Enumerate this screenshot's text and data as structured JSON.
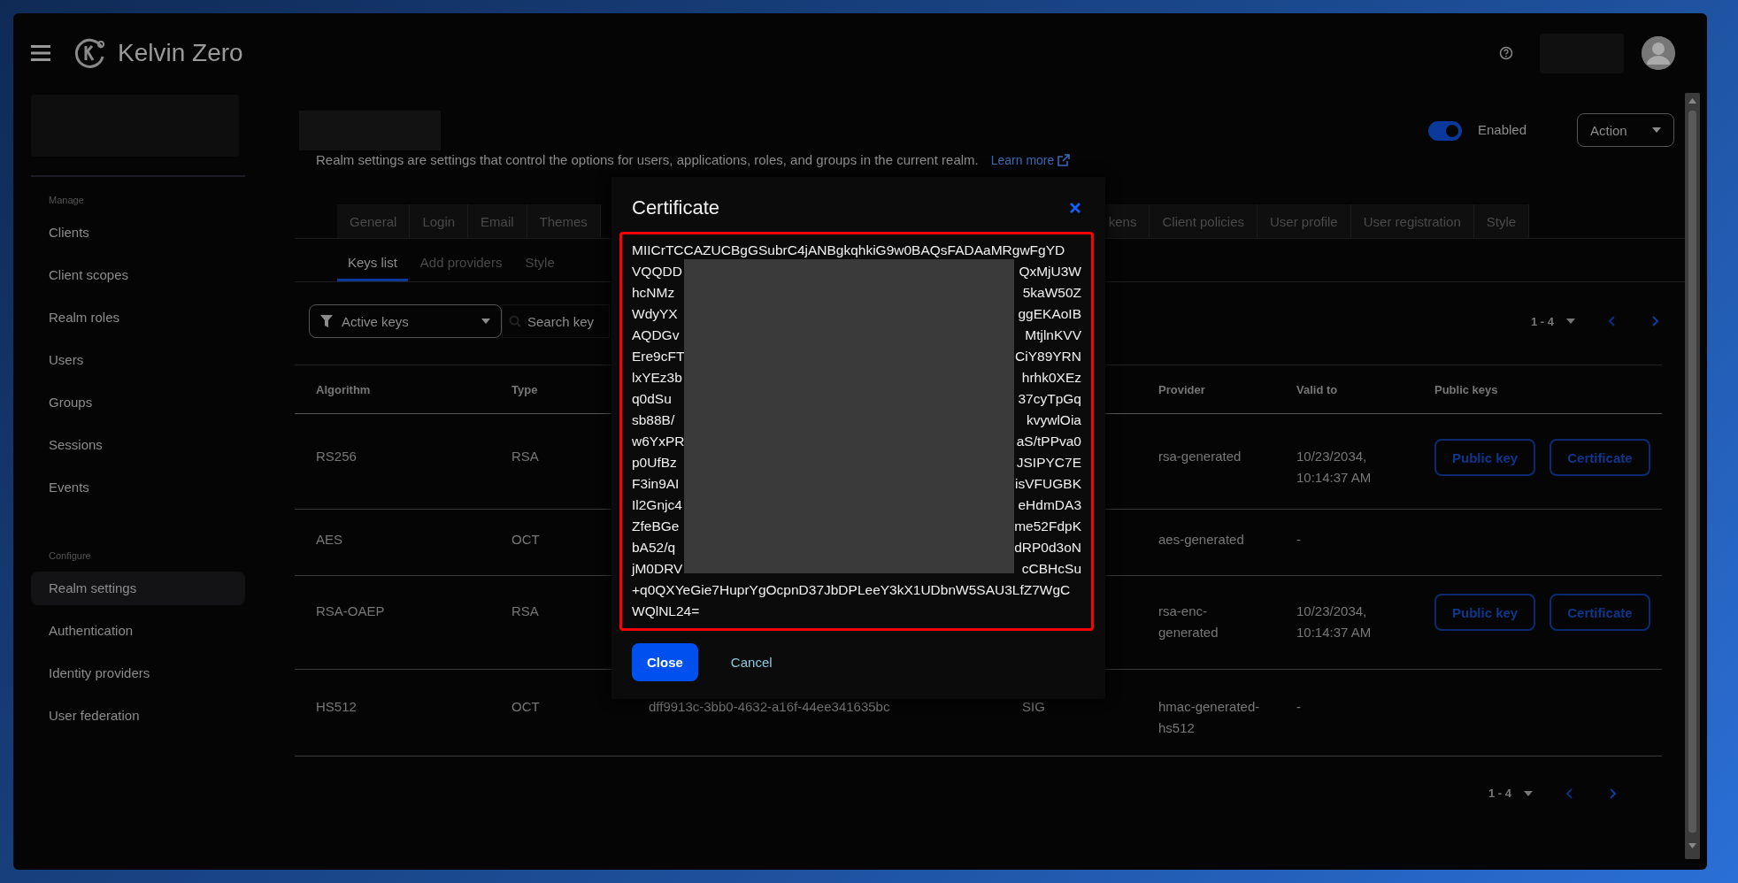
{
  "header": {
    "brand": "Kelvin Zero"
  },
  "sidebar": {
    "sections": [
      {
        "heading": "Manage",
        "items": [
          {
            "label": "Clients",
            "selected": false
          },
          {
            "label": "Client scopes",
            "selected": false
          },
          {
            "label": "Realm roles",
            "selected": false
          },
          {
            "label": "Users",
            "selected": false
          },
          {
            "label": "Groups",
            "selected": false
          },
          {
            "label": "Sessions",
            "selected": false
          },
          {
            "label": "Events",
            "selected": false
          }
        ]
      },
      {
        "heading": "Configure",
        "items": [
          {
            "label": "Realm settings",
            "selected": true
          },
          {
            "label": "Authentication",
            "selected": false
          },
          {
            "label": "Identity providers",
            "selected": false
          },
          {
            "label": "User federation",
            "selected": false
          }
        ]
      }
    ]
  },
  "page": {
    "description": "Realm settings are settings that control the options for users, applications, roles, and groups in the current realm.",
    "learn_more": "Learn more",
    "enabled_toggle": {
      "label": "Enabled",
      "on": true
    },
    "action_menu": "Action"
  },
  "tabs": {
    "before_dialog": [
      {
        "label": "General",
        "selected": false
      },
      {
        "label": "Login",
        "selected": false
      },
      {
        "label": "Email",
        "selected": false
      },
      {
        "label": "Themes",
        "selected": false
      }
    ],
    "after_dialog": [
      {
        "label": "kens",
        "selected": false
      },
      {
        "label": "Client policies",
        "selected": false
      },
      {
        "label": "User profile",
        "selected": false
      },
      {
        "label": "User registration",
        "selected": false
      },
      {
        "label": "Style",
        "selected": false
      }
    ]
  },
  "subtabs": [
    {
      "label": "Keys list",
      "selected": true
    },
    {
      "label": "Add providers",
      "selected": false
    },
    {
      "label": "Style",
      "selected": false
    }
  ],
  "toolbar": {
    "filter": "Active keys",
    "search": {
      "placeholder": "Search key"
    },
    "pagination": "1 - 4"
  },
  "table": {
    "columns": {
      "algorithm": "Algorithm",
      "type": "Type",
      "provider": "Provider",
      "valid_to": "Valid to",
      "public_keys": "Public keys"
    },
    "rows": [
      {
        "algorithm": "RS256",
        "type": "RSA",
        "provider": "rsa-generated",
        "valid_to": "10/23/2034, 10:14:37 AM",
        "public_keys": [
          "Public key",
          "Certificate"
        ]
      },
      {
        "algorithm": "AES",
        "type": "OCT",
        "provider": "aes-generated",
        "valid_to": "-"
      },
      {
        "algorithm": "RSA-OAEP",
        "type": "RSA",
        "provider": "rsa-enc-generated",
        "valid_to": "10/23/2034, 10:14:37 AM",
        "public_keys": [
          "Public key",
          "Certificate"
        ]
      },
      {
        "algorithm": "HS512",
        "type": "OCT",
        "column_3": "dff9913c-3bb0-4632-a16f-44ee341635bc",
        "column_4": "SIG",
        "provider": "hmac-generated-hs512",
        "valid_to": "-"
      }
    ]
  },
  "footer_pagination": "1 - 4",
  "dialog": {
    "title": "Certificate",
    "certificate_lines": [
      {
        "kind": "whole",
        "text": "MIICrTCCAZUCBgGSubrC4jANBgkqhkiG9w0BAQsFADAaMRgwFgYD"
      },
      {
        "kind": "split",
        "start": "VQQDD",
        "end": "QxMjU3W"
      },
      {
        "kind": "split",
        "start": "hcNMz",
        "end": "5kaW50Z"
      },
      {
        "kind": "split",
        "start": "WdyYX",
        "end": "ggEKAoIB"
      },
      {
        "kind": "split",
        "start": "AQDGv",
        "end": "MtjlnKVV"
      },
      {
        "kind": "split",
        "start": "Ere9cFT",
        "end": "CiY89YRN"
      },
      {
        "kind": "split",
        "start": "lxYEz3b",
        "end": "hrhk0XEz"
      },
      {
        "kind": "split",
        "start": "q0dSu",
        "end": "37cyTpGq"
      },
      {
        "kind": "split",
        "start": "sb88B/",
        "end": "kvywlOia"
      },
      {
        "kind": "split",
        "start": "w6YxPR",
        "end": "aS/tPPva0"
      },
      {
        "kind": "split",
        "start": "p0UfBz",
        "end": "JSIPYC7E"
      },
      {
        "kind": "split",
        "start": "F3in9AI",
        "end": "isVFUGBK"
      },
      {
        "kind": "split",
        "start": "Il2Gnjc4",
        "end": "eHdmDA3"
      },
      {
        "kind": "split",
        "start": "ZfeBGe",
        "end": "me52FdpK"
      },
      {
        "kind": "split",
        "start": "bA52/q",
        "end": "dRP0d3oN"
      },
      {
        "kind": "split",
        "start": "jM0DRV",
        "end": "cCBHcSu"
      },
      {
        "kind": "whole",
        "text": "+q0QXYeGie7HuprYgOcpnD37JbDPLeeY3kX1UDbnW5SAU3LfZ7WgC"
      },
      {
        "kind": "whole",
        "text": "WQlNL24="
      }
    ],
    "buttons": [
      {
        "label": "Close",
        "kind": "primary"
      },
      {
        "label": "Cancel",
        "kind": "link"
      }
    ]
  }
}
